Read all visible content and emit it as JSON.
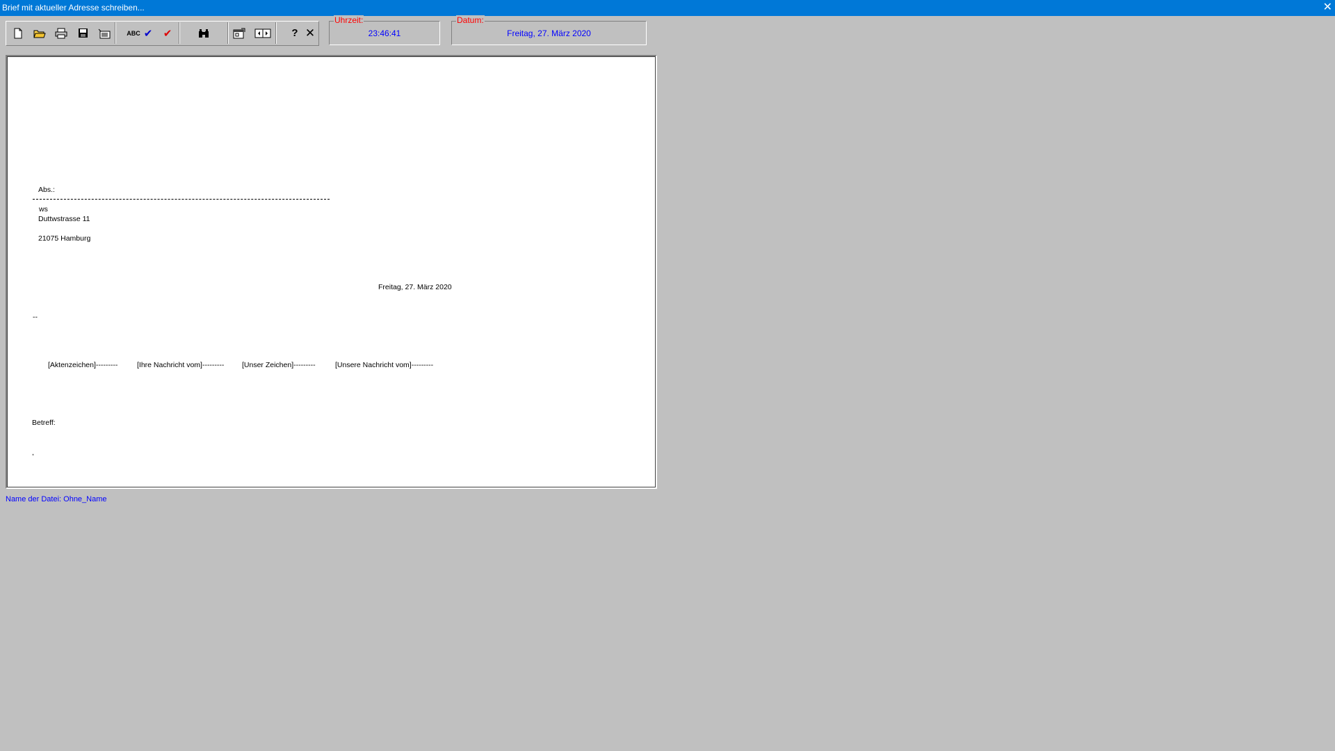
{
  "window": {
    "title": "Brief mit aktueller Adresse schreiben...",
    "close_glyph": "✕"
  },
  "toolbar": {
    "buttons": [
      {
        "name": "new-document-icon"
      },
      {
        "name": "open-folder-icon"
      },
      {
        "name": "print-icon"
      },
      {
        "name": "save-icon"
      },
      {
        "name": "insert-address-icon"
      },
      {
        "name": "abc-spellcheck-icon",
        "label": "ABC"
      },
      {
        "name": "check-blue-icon",
        "label": "✔"
      },
      {
        "name": "check-red-icon",
        "label": "✔"
      },
      {
        "name": "binoculars-search-icon"
      },
      {
        "name": "settings-dialog-icon"
      },
      {
        "name": "page-navigation-icon"
      },
      {
        "name": "help-icon",
        "label": "?"
      },
      {
        "name": "close-icon",
        "label": "✕"
      }
    ]
  },
  "time": {
    "label": "Uhrzeit:",
    "value": "23:46:41"
  },
  "date": {
    "label": "Datum:",
    "value": "Freitag, 27. März 2020"
  },
  "letter": {
    "sender_label": "Abs.:",
    "recipient_name": "ws",
    "recipient_street": "Duttwstrasse 11",
    "recipient_city": "21075 Hamburg",
    "date": "Freitag, 27. März 2020",
    "salutation_line": "--",
    "reference_fields": [
      "[Aktenzeichen]---------",
      "[Ihre Nachricht vom]---------",
      "[Unser Zeichen]---------",
      "[Unsere Nachricht vom]---------"
    ],
    "subject_label": "Betreff:",
    "body_start": ","
  },
  "status": {
    "filename": "Name der Datei: Ohne_Name"
  },
  "colors": {
    "titlebar": "#0078d7",
    "legend": "#ff0000",
    "value": "#0000ff",
    "background": "#c0c0c0"
  }
}
